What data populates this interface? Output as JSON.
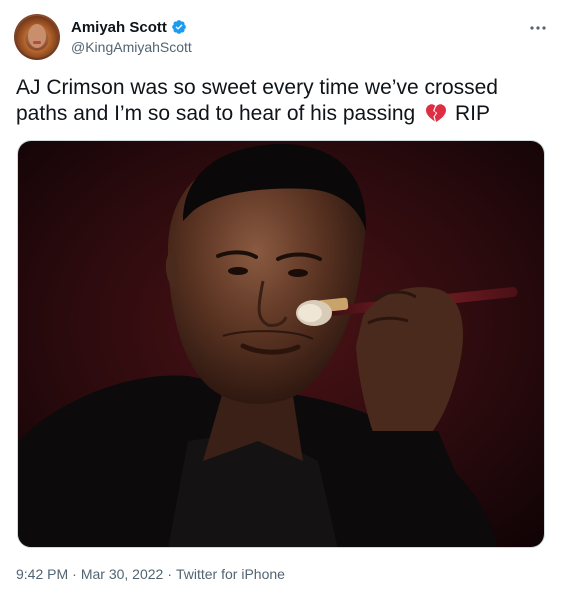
{
  "author": {
    "display_name": "Amiyah Scott",
    "handle": "@KingAmiyahScott",
    "verified": true,
    "badge_color": "#1d9bf0"
  },
  "tweet": {
    "text_part1": "AJ Crimson was so sweet every time we’ve crossed paths and I’m so sad to hear of his passing",
    "emoji": "broken-heart-icon",
    "text_part2": "RIP"
  },
  "media": {
    "type": "photo",
    "subject": "man-applying-makeup-brush-photo"
  },
  "meta": {
    "time": "9:42 PM",
    "date": "Mar 30, 2022",
    "source": "Twitter for iPhone",
    "separator": "·"
  },
  "icons": {
    "more": "more-icon",
    "verified": "verified-badge-icon"
  }
}
